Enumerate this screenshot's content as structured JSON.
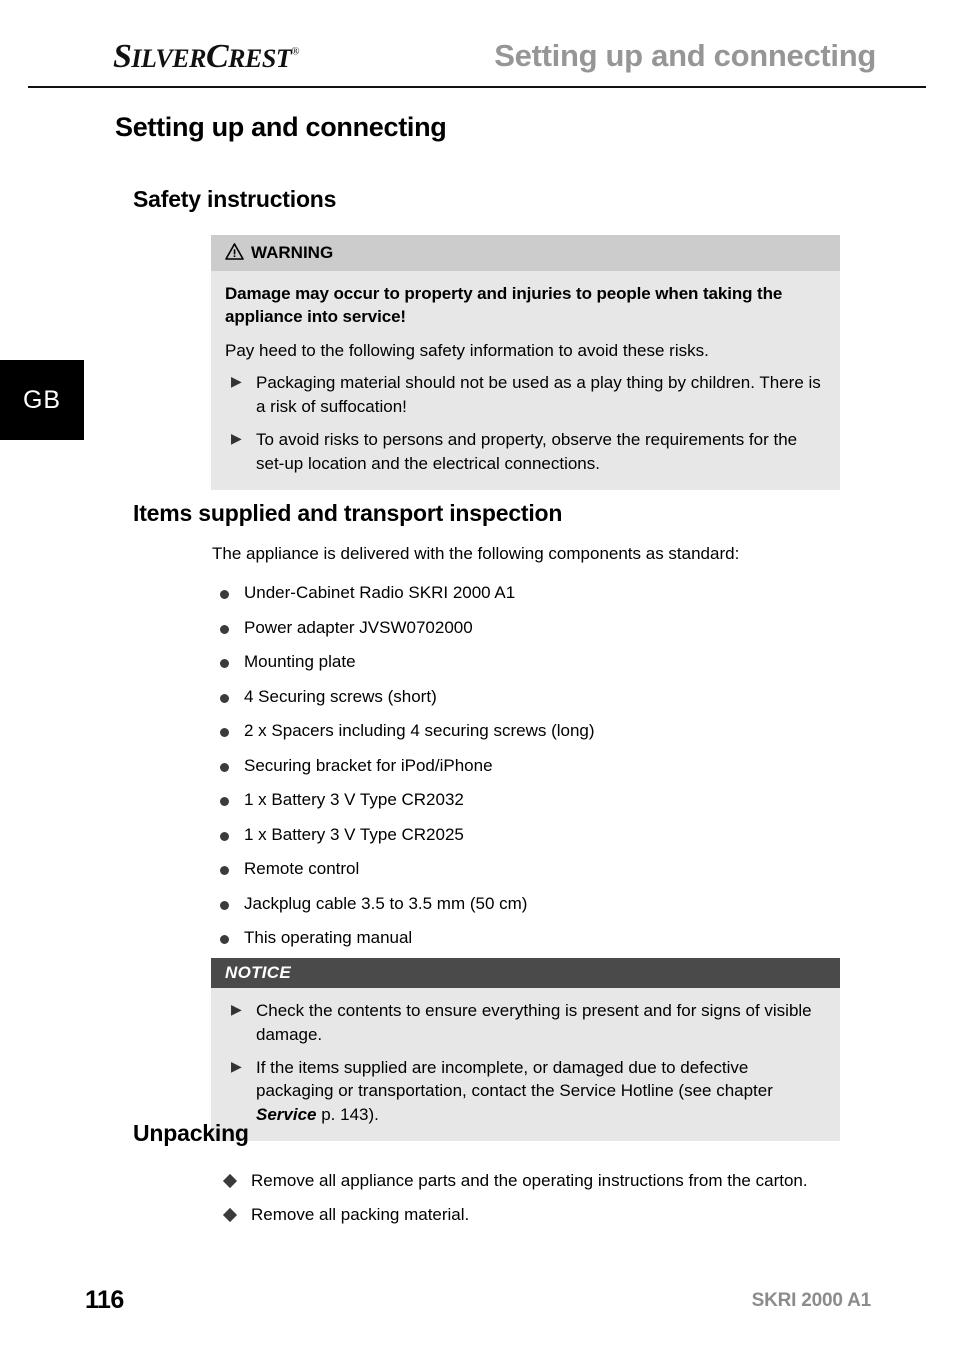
{
  "header": {
    "brand": "SILVERCREST",
    "brand_registered_mark": "®",
    "running_title": "Setting up and connecting"
  },
  "country_tab": {
    "label": "GB"
  },
  "document": {
    "title": "Setting up and connecting",
    "sections": {
      "safety": {
        "heading": "Safety instructions",
        "warning_box": {
          "head_label": "WARNING",
          "icon": "warning-triangle-icon",
          "bold_lead": "Damage may occur to property and injuries to people when taking the appliance into service!",
          "intro": "Pay heed to the following safety information to avoid these risks.",
          "bullets": [
            "Packaging material should not be used as a play thing by children. There is a risk of suffocation!",
            "To avoid risks to persons and property, observe the requirements for the set-up location and the electrical connections."
          ]
        }
      },
      "items_supplied": {
        "heading": "Items supplied and transport inspection",
        "lead": "The appliance is delivered with the following components as standard:",
        "items": [
          "Under-Cabinet Radio SKRI 2000 A1",
          "Power adapter JVSW0702000",
          "Mounting plate",
          "4 Securing screws (short)",
          "2 x Spacers including 4 securing screws (long)",
          "Securing bracket for iPod/iPhone",
          "1 x Battery 3 V Type CR2032",
          "1 x Battery 3 V Type CR2025",
          "Remote control",
          "Jackplug cable 3.5 to 3.5 mm (50 cm)",
          "This operating manual"
        ],
        "notice_box": {
          "head_label": "NOTICE",
          "bullets": [
            "Check the contents to ensure everything is present and for signs of visible damage."
          ],
          "bullet_two_part_a": "If the items supplied are incomplete, or damaged due to defective packaging or transportation, contact the Service Hotline (see chapter ",
          "bullet_two_emphasis": "Service",
          "bullet_two_part_b": " p. 143)."
        }
      },
      "unpacking": {
        "heading": "Unpacking",
        "steps": [
          "Remove all appliance parts and the operating instructions from the carton.",
          "Remove all packing material."
        ]
      }
    }
  },
  "footer": {
    "page_number": "116",
    "model": "SKRI 2000 A1"
  },
  "colors": {
    "running_title_gray": "#969696",
    "warning_head_gray": "#cccccc",
    "callout_body_gray": "#e7e7e7",
    "notice_head_dark": "#4a4a4a",
    "footer_model_gray": "#8c8c8c",
    "tab_black": "#000000"
  }
}
